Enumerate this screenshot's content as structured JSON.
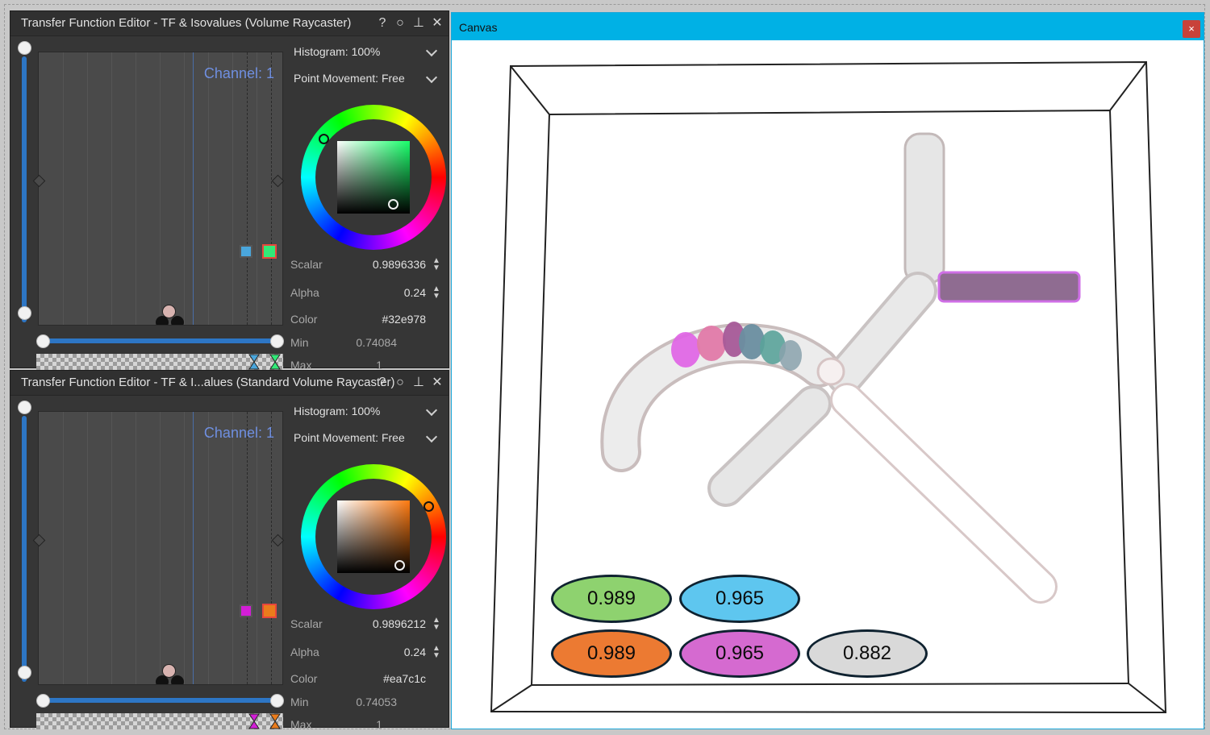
{
  "editors": [
    {
      "title": "Transfer Function Editor - TF & Isovalues (Volume Raycaster)",
      "channel_label": "Channel: 1",
      "histogram": "Histogram: 100%",
      "point_movement": "Point Movement: Free",
      "scalar_label": "Scalar",
      "scalar_value": "0.9896336",
      "alpha_label": "Alpha",
      "alpha_value": "0.24",
      "color_label": "Color",
      "color_value": "#32e978",
      "min_label": "Min",
      "min_value": "0.74084",
      "max_label": "Max",
      "max_value": "1",
      "iso_colors": [
        "#4aa6dc",
        "#32e978"
      ],
      "selected_color": "#32e978"
    },
    {
      "title": "Transfer Function Editor - TF & I...alues (Standard Volume Raycaster)",
      "channel_label": "Channel: 1",
      "histogram": "Histogram: 100%",
      "point_movement": "Point Movement: Free",
      "scalar_label": "Scalar",
      "scalar_value": "0.9896212",
      "alpha_label": "Alpha",
      "alpha_value": "0.24",
      "color_label": "Color",
      "color_value": "#ea7c1c",
      "min_label": "Min",
      "min_value": "0.74053",
      "max_label": "Max",
      "max_value": "1",
      "iso_colors": [
        "#d21ed6",
        "#ea7c1c"
      ],
      "selected_color": "#ea7c1c"
    }
  ],
  "title_buttons": {
    "help": "?",
    "float": "○",
    "pin": "⊥",
    "close": "✕"
  },
  "icons": [
    "help-icon",
    "undock-icon",
    "pin-icon",
    "close-icon",
    "chevron-down-icon",
    "spinner-icon"
  ],
  "canvas": {
    "title": "Canvas",
    "close": "×",
    "badges": [
      {
        "label": "0.989",
        "color": "#8ed26f"
      },
      {
        "label": "0.965",
        "color": "#5ec6ef"
      },
      {
        "label": "0.989",
        "color": "#ec7a32"
      },
      {
        "label": "0.965",
        "color": "#d56ad0"
      },
      {
        "label": "0.882",
        "color": "#d9d9d9"
      }
    ]
  }
}
